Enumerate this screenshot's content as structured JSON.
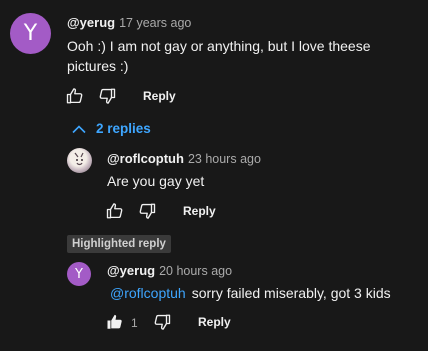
{
  "colors": {
    "background": "#181818",
    "avatar_purple": "#a35bc6",
    "link_blue": "#3ea6ff"
  },
  "main_comment": {
    "avatar_letter": "Y",
    "handle": "@yerug",
    "time": "17 years ago",
    "text_line1": "Ooh :) I am not gay or anything, but I love theese",
    "text_line2": "pictures :)",
    "reply_label": "Reply"
  },
  "replies_toggle": {
    "label": "2 replies",
    "icon": "chevron-up-icon"
  },
  "reply_1": {
    "handle": "@roflcoptuh",
    "time": "23 hours ago",
    "text": "Are you gay yet",
    "reply_label": "Reply"
  },
  "highlighted": {
    "badge": "Highlighted reply",
    "avatar_letter": "Y",
    "handle": "@yerug",
    "time": "20 hours ago",
    "mention": "@roflcoptuh",
    "text": "sorry failed miserably, got 3 kids",
    "likes": "1",
    "reply_label": "Reply"
  }
}
